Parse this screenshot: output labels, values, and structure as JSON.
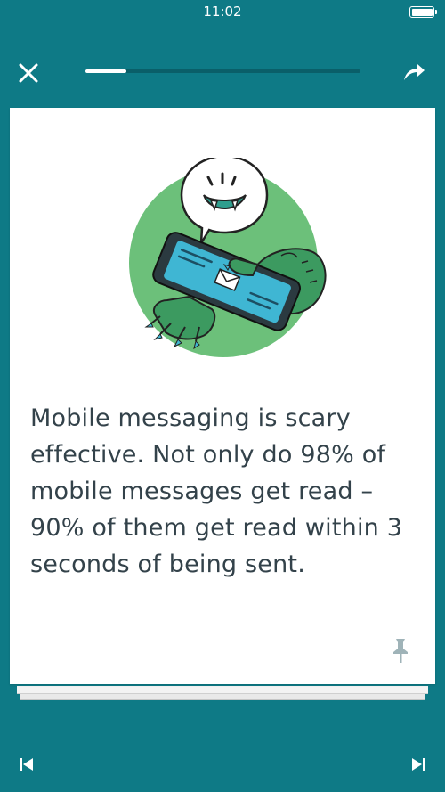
{
  "status_bar": {
    "time": "11:02"
  },
  "toolbar": {
    "progress": 0.15
  },
  "card": {
    "text": "Mobile messaging is scary effective. Not only do 98% of mobile messages get read – 90% of them get read within 3 seconds of being sent."
  },
  "icons": {
    "close": "close-icon",
    "share": "share-arrow-icon",
    "pin": "pin-icon",
    "prev": "skip-previous-icon",
    "next": "skip-next-icon"
  },
  "colors": {
    "background": "#0e7a86",
    "accent_green": "#6cc07a",
    "accent_blue": "#3fb6d3",
    "text": "#33424a"
  }
}
